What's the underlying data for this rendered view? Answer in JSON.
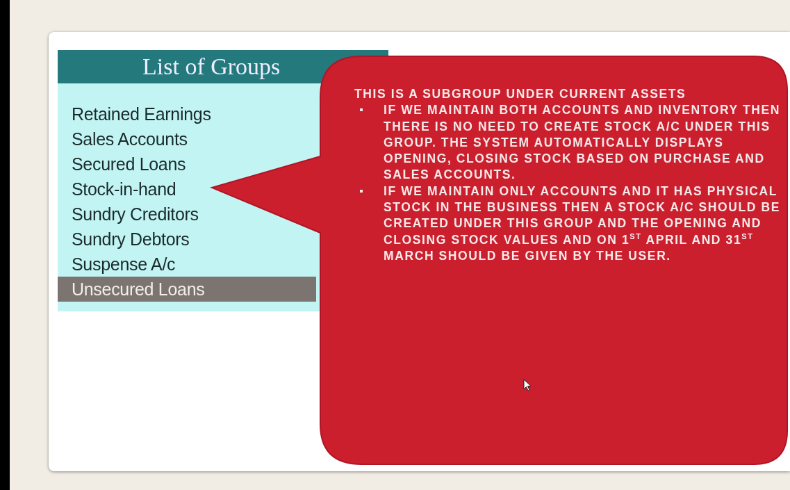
{
  "list": {
    "title": "List of Groups",
    "items": [
      {
        "label": "Retained Earnings",
        "selected": false
      },
      {
        "label": "Sales Accounts",
        "selected": false
      },
      {
        "label": "Secured Loans",
        "selected": false
      },
      {
        "label": "Stock-in-hand",
        "selected": false
      },
      {
        "label": "Sundry Creditors",
        "selected": false
      },
      {
        "label": "Sundry Debtors",
        "selected": false
      },
      {
        "label": "Suspense A/c",
        "selected": false
      },
      {
        "label": "Unsecured Loans",
        "selected": true
      }
    ]
  },
  "callout": {
    "heading": "THIS IS A SUBGROUP UNDER CURRENT ASSETS",
    "bullets": [
      "IF WE MAINTAIN BOTH ACCOUNTS AND INVENTORY THEN THERE IS NO NEED TO CREATE STOCK A/C UNDER THIS GROUP. THE SYSTEM AUTOMATICALLY DISPLAYS OPENING, CLOSING STOCK BASED ON PURCHASE AND SALES ACCOUNTS.",
      "IF WE MAINTAIN ONLY ACCOUNTS AND IT HAS PHYSICAL STOCK IN THE BUSINESS THEN A STOCK A/C SHOULD BE CREATED UNDER THIS GROUP AND THE OPENING AND CLOSING STOCK VALUES AND ON 1$^{ST}$ APRIL AND 31$^{ST}$ MARCH SHOULD BE GIVEN BY THE USER."
    ]
  }
}
